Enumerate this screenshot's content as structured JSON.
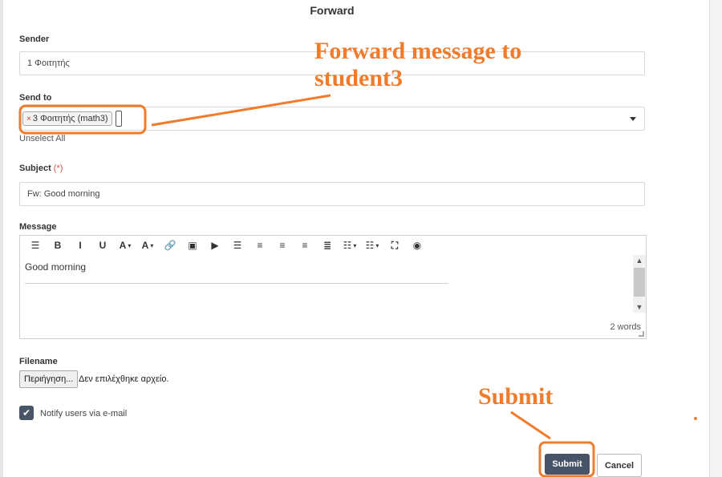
{
  "modal": {
    "title": "Forward"
  },
  "sender": {
    "label": "Sender",
    "value": "1 Φοιτητής"
  },
  "send_to": {
    "label": "Send to",
    "chip_remove": "×",
    "chip_text": "3 Φοιτητής (math3)",
    "unselect_all": "Unselect All"
  },
  "subject": {
    "label": "Subject",
    "required_mark": "(*)",
    "value": "Fw: Good morning"
  },
  "message": {
    "label": "Message",
    "body": "Good morning",
    "word_count": "2 words",
    "toolbar": [
      {
        "name": "menu-icon",
        "glyph": "☰",
        "dropdown": false
      },
      {
        "name": "bold-icon",
        "glyph": "B",
        "dropdown": false
      },
      {
        "name": "italic-icon",
        "glyph": "I",
        "dropdown": false
      },
      {
        "name": "underline-icon",
        "glyph": "U",
        "dropdown": false
      },
      {
        "name": "text-color-icon",
        "glyph": "A",
        "dropdown": true
      },
      {
        "name": "font-size-icon",
        "glyph": "A",
        "dropdown": true
      },
      {
        "name": "link-icon",
        "glyph": "🔗",
        "dropdown": false
      },
      {
        "name": "image-icon",
        "glyph": "▣",
        "dropdown": false
      },
      {
        "name": "video-icon",
        "glyph": "▶",
        "dropdown": false
      },
      {
        "name": "align-justify-icon",
        "glyph": "☰",
        "dropdown": false
      },
      {
        "name": "align-left-icon",
        "glyph": "≡",
        "dropdown": false
      },
      {
        "name": "align-center-icon",
        "glyph": "≡",
        "dropdown": false
      },
      {
        "name": "align-right-icon",
        "glyph": "≡",
        "dropdown": false
      },
      {
        "name": "align-full-icon",
        "glyph": "≣",
        "dropdown": false
      },
      {
        "name": "bullet-list-icon",
        "glyph": "☷",
        "dropdown": true
      },
      {
        "name": "numbered-list-icon",
        "glyph": "☷",
        "dropdown": true
      },
      {
        "name": "fullscreen-icon",
        "glyph": "⛶",
        "dropdown": false
      },
      {
        "name": "preview-icon",
        "glyph": "◉",
        "dropdown": false
      }
    ]
  },
  "file": {
    "label": "Filename",
    "button": "Περιήγηση...",
    "status": "Δεν επιλέχθηκε αρχείο."
  },
  "notify": {
    "label": "Notify users via e-mail",
    "checked": true
  },
  "actions": {
    "submit": "Submit",
    "cancel": "Cancel"
  },
  "annotations": {
    "forward_note": "Forward message to student3",
    "submit_note": "Submit",
    "color": "#f07b2a"
  },
  "colors": {
    "primary": "#475468",
    "required": "#d9534f"
  }
}
